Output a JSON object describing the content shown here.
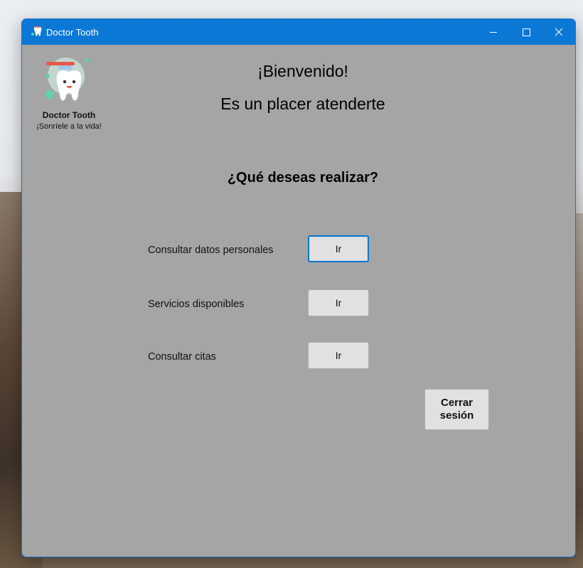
{
  "window": {
    "title": "Doctor Tooth"
  },
  "brand": {
    "name": "Doctor Tooth",
    "tagline": "¡Sonríele a la vida!"
  },
  "welcome": {
    "line1": "¡Bienvenido!",
    "line2": "Es un placer atenderte"
  },
  "question": "¿Qué deseas realizar?",
  "options": [
    {
      "label": "Consultar datos personales",
      "button": "Ir"
    },
    {
      "label": "Servicios disponibles",
      "button": "Ir"
    },
    {
      "label": "Consultar citas",
      "button": "Ir"
    }
  ],
  "logout": {
    "label": "Cerrar\nsesión"
  },
  "colors": {
    "titlebar": "#0c78d6",
    "background": "#a5a5a5",
    "button": "#e1e1e1",
    "focus": "#0078d4"
  }
}
